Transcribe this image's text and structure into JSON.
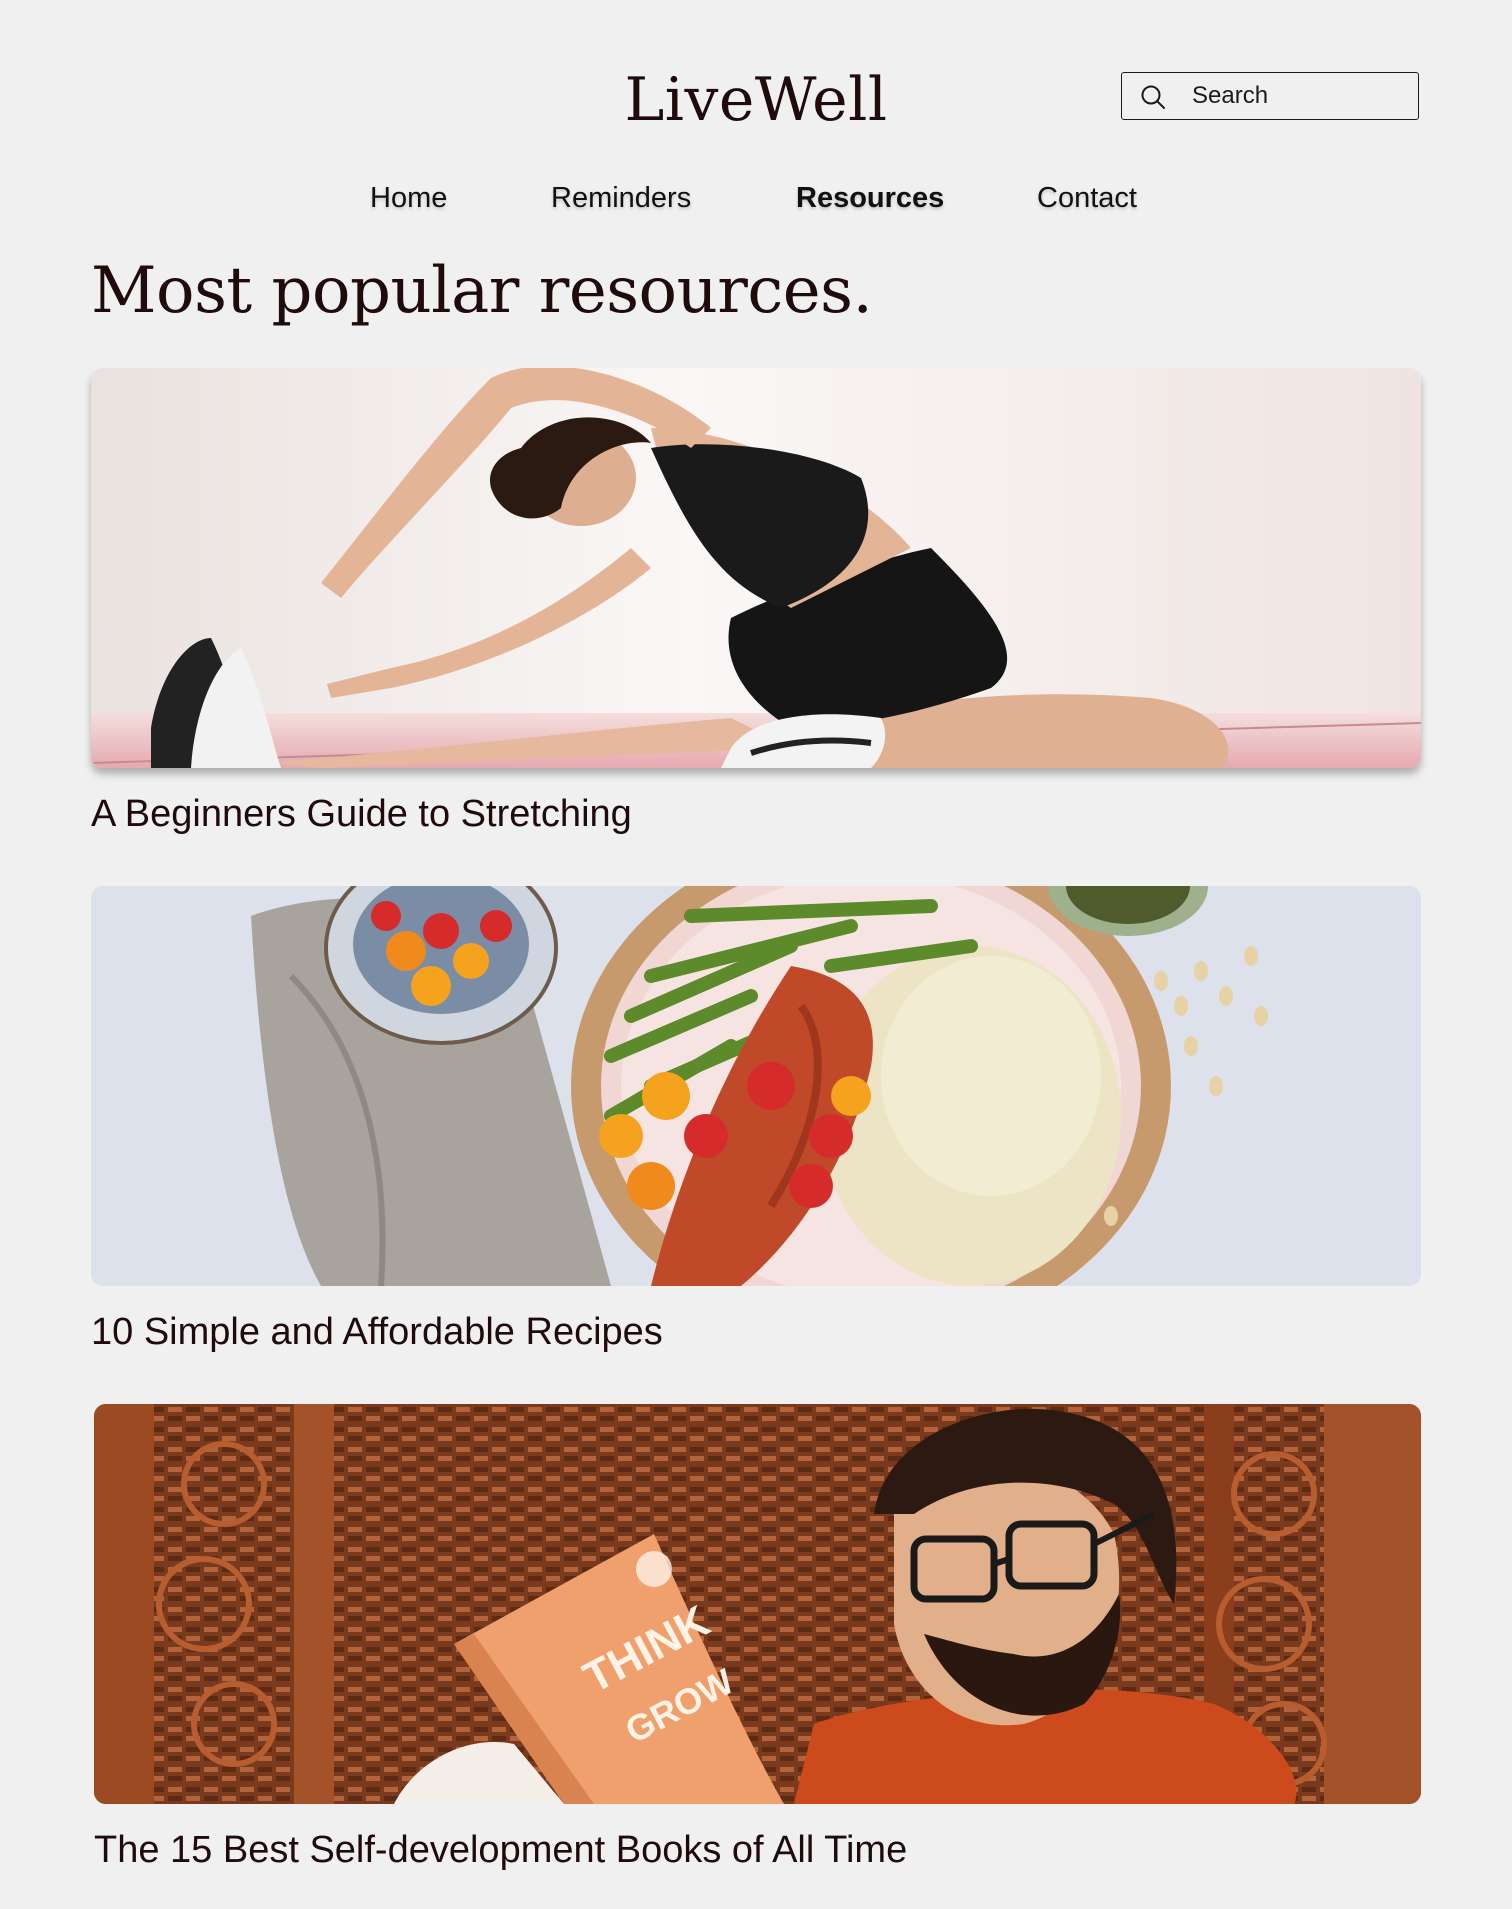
{
  "brand": {
    "logo_text": "LiveWell"
  },
  "search": {
    "placeholder": "Search",
    "icon": "search-icon"
  },
  "nav": {
    "items": [
      {
        "label": "Home",
        "active": false
      },
      {
        "label": "Reminders",
        "active": false
      },
      {
        "label": "Resources",
        "active": true
      },
      {
        "label": "Contact",
        "active": false
      }
    ]
  },
  "page": {
    "title": "Most popular resources."
  },
  "resources": [
    {
      "title": "A Beginners Guide to Stretching",
      "image": "woman-stretching-photo"
    },
    {
      "title": "10 Simple and Affordable Recipes",
      "image": "salmon-rice-plate-photo"
    },
    {
      "title": "The 15 Best Self-development Books of All Time",
      "image": "man-reading-book-photo"
    }
  ],
  "colors": {
    "background": "#f0f0f0",
    "heading": "#1f0b0b",
    "text": "#2a0f0f"
  }
}
